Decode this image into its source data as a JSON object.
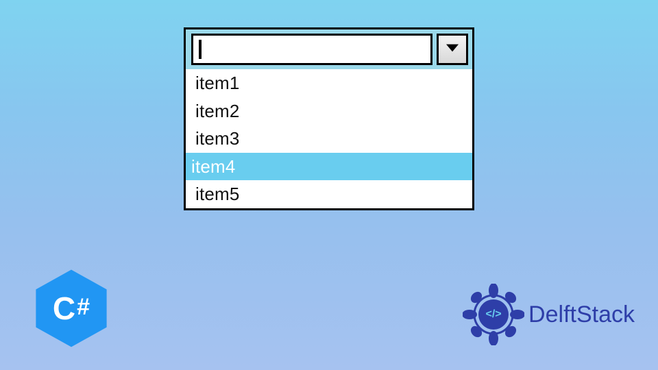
{
  "combobox": {
    "input_value": "",
    "items": [
      {
        "label": "item1",
        "selected": false
      },
      {
        "label": "item2",
        "selected": false
      },
      {
        "label": "item3",
        "selected": false
      },
      {
        "label": "item4",
        "selected": true
      },
      {
        "label": "item5",
        "selected": false
      }
    ]
  },
  "badges": {
    "csharp": "C#",
    "delftstack": "DelftStack",
    "delft_center": "</>"
  },
  "colors": {
    "highlight": "#69cdef",
    "csharp_blue": "#2196f3",
    "delft_blue": "#2e3ea8"
  }
}
